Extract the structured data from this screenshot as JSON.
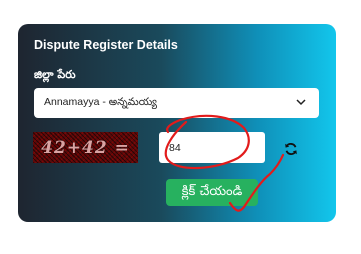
{
  "form": {
    "title": "Dispute Register Details",
    "district_label": "జిల్లా పేరు",
    "district_selected": "Annamayya - అన్నమయ్య",
    "captcha_text": "42+42 =",
    "captcha_answer": "84",
    "submit_label": "క్లిక్ చేయండి"
  },
  "icons": {
    "dropdown": "chevron-down-icon",
    "refresh": "refresh-icon"
  },
  "colors": {
    "card_gradient_start": "#1e2530",
    "card_gradient_end": "#12c6ec",
    "submit_bg": "#27b15f",
    "annotation": "#e21b1b"
  }
}
